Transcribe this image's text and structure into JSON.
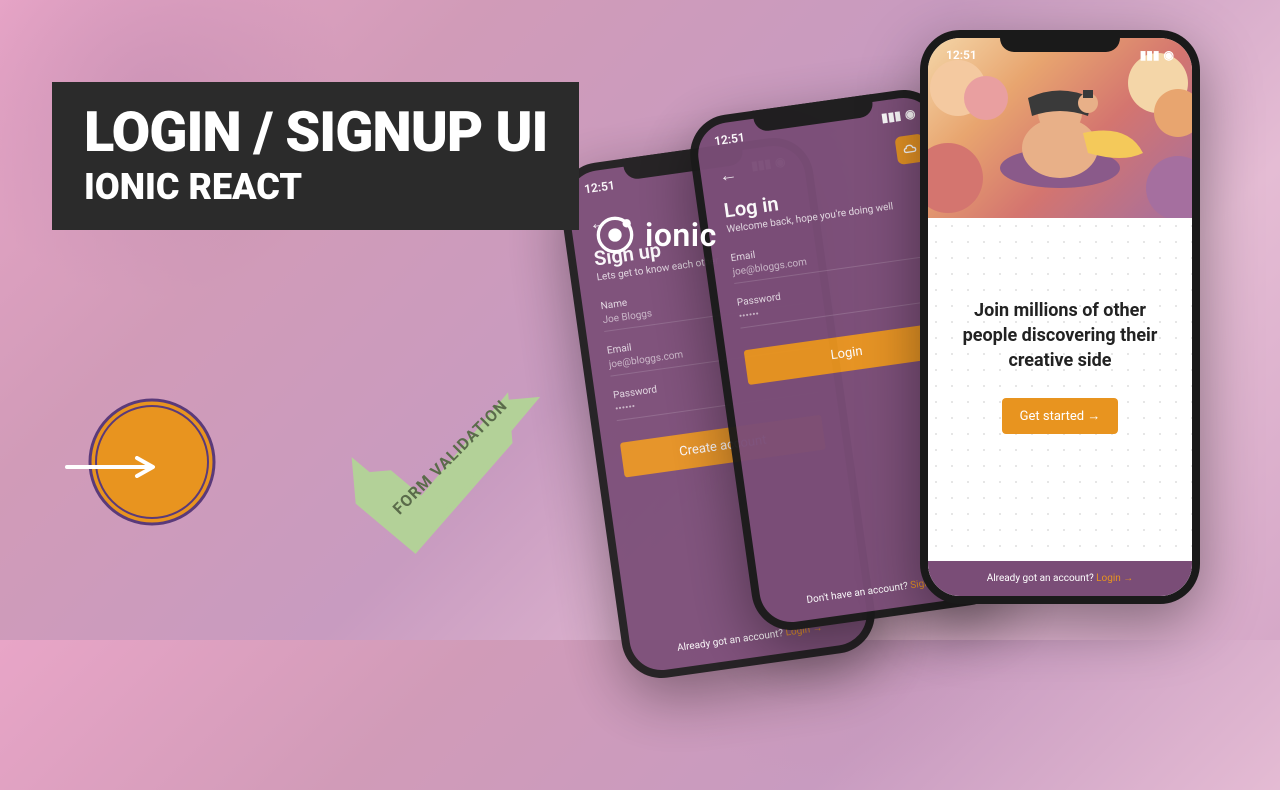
{
  "title": {
    "main": "LOGIN / SIGNUP UI",
    "sub": "IONIC REACT"
  },
  "ionic_label": "ionic",
  "checkmark_label": "FORM VALIDATION",
  "status_time": "12:51",
  "signup": {
    "title": "Sign up",
    "sub": "Lets get to know each other",
    "name_label": "Name",
    "name_placeholder": "Joe Bloggs",
    "email_label": "Email",
    "email_placeholder": "joe@bloggs.com",
    "password_label": "Password",
    "password_placeholder": "••••••",
    "button": "Create account",
    "footer_text": "Already got an account? ",
    "footer_link": "Login →"
  },
  "login": {
    "title": "Log in",
    "sub": "Welcome back, hope you're doing well",
    "email_label": "Email",
    "email_placeholder": "joe@bloggs.com",
    "password_label": "Password",
    "password_placeholder": "••••••",
    "button": "Login",
    "footer_text": "Don't have an account? ",
    "footer_link": "Signup →"
  },
  "landing": {
    "headline": "Join millions of other people discovering their creative side",
    "button": "Get started →",
    "footer_text": "Already got an account? ",
    "footer_link": "Login →"
  },
  "colors": {
    "accent": "#e8941f",
    "purple": "#7a4d77"
  }
}
